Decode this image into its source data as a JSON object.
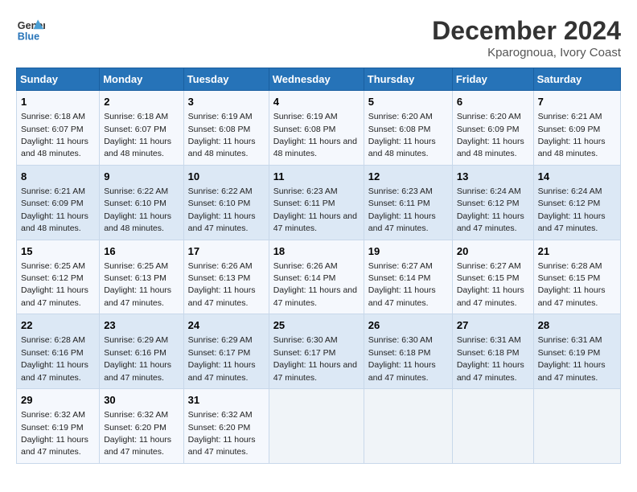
{
  "logo": {
    "line1": "General",
    "line2": "Blue"
  },
  "title": "December 2024",
  "location": "Kparognoua, Ivory Coast",
  "days_of_week": [
    "Sunday",
    "Monday",
    "Tuesday",
    "Wednesday",
    "Thursday",
    "Friday",
    "Saturday"
  ],
  "weeks": [
    [
      {
        "day": 1,
        "sunrise": "6:18 AM",
        "sunset": "6:07 PM",
        "daylight": "11 hours and 48 minutes."
      },
      {
        "day": 2,
        "sunrise": "6:18 AM",
        "sunset": "6:07 PM",
        "daylight": "11 hours and 48 minutes."
      },
      {
        "day": 3,
        "sunrise": "6:19 AM",
        "sunset": "6:08 PM",
        "daylight": "11 hours and 48 minutes."
      },
      {
        "day": 4,
        "sunrise": "6:19 AM",
        "sunset": "6:08 PM",
        "daylight": "11 hours and 48 minutes."
      },
      {
        "day": 5,
        "sunrise": "6:20 AM",
        "sunset": "6:08 PM",
        "daylight": "11 hours and 48 minutes."
      },
      {
        "day": 6,
        "sunrise": "6:20 AM",
        "sunset": "6:09 PM",
        "daylight": "11 hours and 48 minutes."
      },
      {
        "day": 7,
        "sunrise": "6:21 AM",
        "sunset": "6:09 PM",
        "daylight": "11 hours and 48 minutes."
      }
    ],
    [
      {
        "day": 8,
        "sunrise": "6:21 AM",
        "sunset": "6:09 PM",
        "daylight": "11 hours and 48 minutes."
      },
      {
        "day": 9,
        "sunrise": "6:22 AM",
        "sunset": "6:10 PM",
        "daylight": "11 hours and 48 minutes."
      },
      {
        "day": 10,
        "sunrise": "6:22 AM",
        "sunset": "6:10 PM",
        "daylight": "11 hours and 47 minutes."
      },
      {
        "day": 11,
        "sunrise": "6:23 AM",
        "sunset": "6:11 PM",
        "daylight": "11 hours and 47 minutes."
      },
      {
        "day": 12,
        "sunrise": "6:23 AM",
        "sunset": "6:11 PM",
        "daylight": "11 hours and 47 minutes."
      },
      {
        "day": 13,
        "sunrise": "6:24 AM",
        "sunset": "6:12 PM",
        "daylight": "11 hours and 47 minutes."
      },
      {
        "day": 14,
        "sunrise": "6:24 AM",
        "sunset": "6:12 PM",
        "daylight": "11 hours and 47 minutes."
      }
    ],
    [
      {
        "day": 15,
        "sunrise": "6:25 AM",
        "sunset": "6:12 PM",
        "daylight": "11 hours and 47 minutes."
      },
      {
        "day": 16,
        "sunrise": "6:25 AM",
        "sunset": "6:13 PM",
        "daylight": "11 hours and 47 minutes."
      },
      {
        "day": 17,
        "sunrise": "6:26 AM",
        "sunset": "6:13 PM",
        "daylight": "11 hours and 47 minutes."
      },
      {
        "day": 18,
        "sunrise": "6:26 AM",
        "sunset": "6:14 PM",
        "daylight": "11 hours and 47 minutes."
      },
      {
        "day": 19,
        "sunrise": "6:27 AM",
        "sunset": "6:14 PM",
        "daylight": "11 hours and 47 minutes."
      },
      {
        "day": 20,
        "sunrise": "6:27 AM",
        "sunset": "6:15 PM",
        "daylight": "11 hours and 47 minutes."
      },
      {
        "day": 21,
        "sunrise": "6:28 AM",
        "sunset": "6:15 PM",
        "daylight": "11 hours and 47 minutes."
      }
    ],
    [
      {
        "day": 22,
        "sunrise": "6:28 AM",
        "sunset": "6:16 PM",
        "daylight": "11 hours and 47 minutes."
      },
      {
        "day": 23,
        "sunrise": "6:29 AM",
        "sunset": "6:16 PM",
        "daylight": "11 hours and 47 minutes."
      },
      {
        "day": 24,
        "sunrise": "6:29 AM",
        "sunset": "6:17 PM",
        "daylight": "11 hours and 47 minutes."
      },
      {
        "day": 25,
        "sunrise": "6:30 AM",
        "sunset": "6:17 PM",
        "daylight": "11 hours and 47 minutes."
      },
      {
        "day": 26,
        "sunrise": "6:30 AM",
        "sunset": "6:18 PM",
        "daylight": "11 hours and 47 minutes."
      },
      {
        "day": 27,
        "sunrise": "6:31 AM",
        "sunset": "6:18 PM",
        "daylight": "11 hours and 47 minutes."
      },
      {
        "day": 28,
        "sunrise": "6:31 AM",
        "sunset": "6:19 PM",
        "daylight": "11 hours and 47 minutes."
      }
    ],
    [
      {
        "day": 29,
        "sunrise": "6:32 AM",
        "sunset": "6:19 PM",
        "daylight": "11 hours and 47 minutes."
      },
      {
        "day": 30,
        "sunrise": "6:32 AM",
        "sunset": "6:20 PM",
        "daylight": "11 hours and 47 minutes."
      },
      {
        "day": 31,
        "sunrise": "6:32 AM",
        "sunset": "6:20 PM",
        "daylight": "11 hours and 47 minutes."
      },
      null,
      null,
      null,
      null
    ]
  ]
}
